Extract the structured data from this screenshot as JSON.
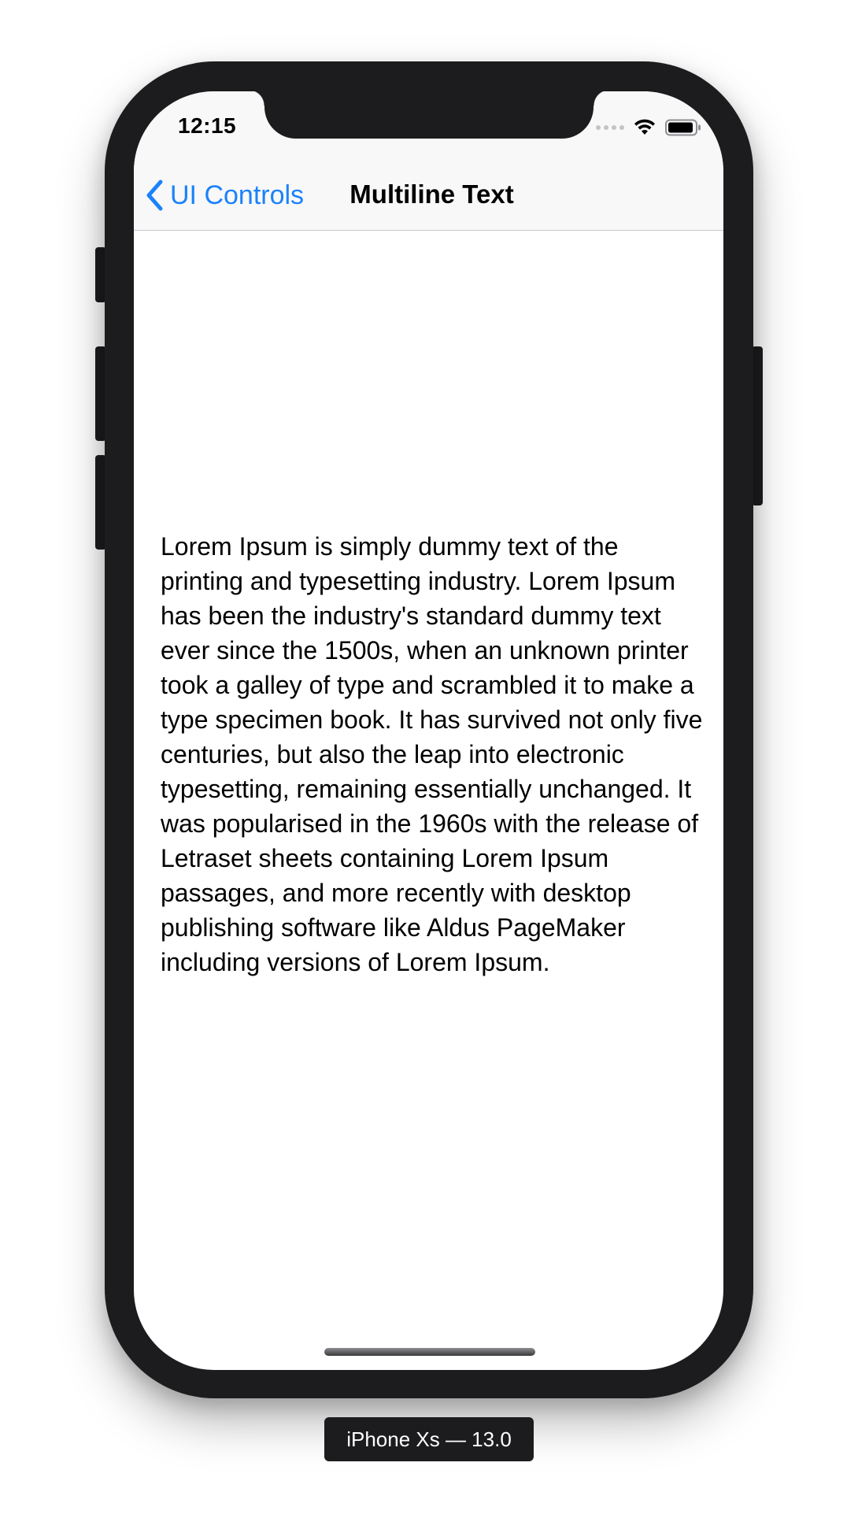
{
  "status_bar": {
    "time": "12:15",
    "icons": [
      "cellular-signal-icon",
      "wifi-icon",
      "battery-icon"
    ]
  },
  "nav": {
    "back_label": "UI Controls",
    "title": "Multiline Text"
  },
  "content": {
    "paragraph": "Lorem Ipsum is simply dummy text of the printing and typesetting industry. Lorem Ipsum has been the industry's standard dummy text ever since the 1500s, when an unknown printer took a galley of type and scrambled it to make a type specimen book. It has survived not only five centuries, but also the leap into electronic typesetting, remaining essentially unchanged. It was popularised in the 1960s with the release of Letraset sheets containing Lorem Ipsum passages, and more recently with desktop publishing software like Aldus PageMaker including versions of Lorem Ipsum."
  },
  "simulator": {
    "device_label": "iPhone Xs — 13.0"
  },
  "colors": {
    "accent": "#1a82fb",
    "nav_background": "#f8f8f8",
    "device_frame": "#1c1c1e"
  }
}
